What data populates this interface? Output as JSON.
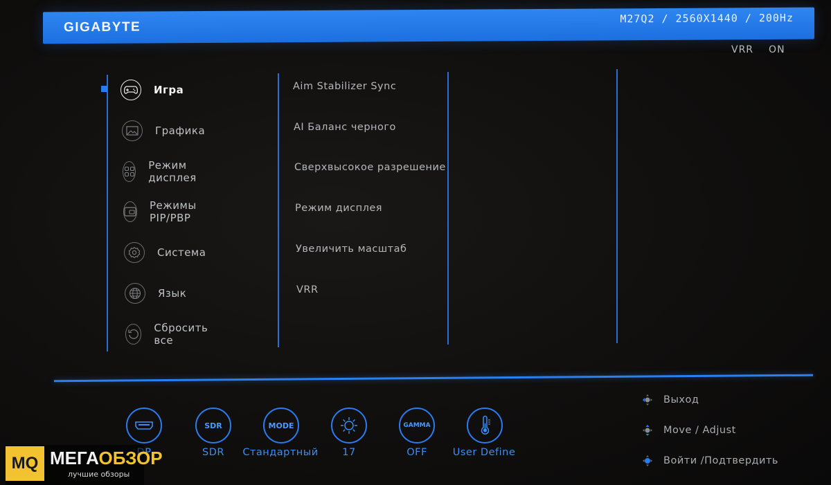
{
  "header": {
    "brand": "GIGABYTE",
    "model": "M27Q2",
    "resolution": "2560X1440",
    "refresh": "200Hz",
    "separator": "/"
  },
  "status": {
    "label": "VRR",
    "value": "ON"
  },
  "main_menu": {
    "items": [
      {
        "label": "Игра",
        "icon": "gamepad-icon",
        "active": true
      },
      {
        "label": "Графика",
        "icon": "picture-icon",
        "active": false
      },
      {
        "label": "Режим дисплея",
        "icon": "grid-icon",
        "active": false
      },
      {
        "label": "Режимы PIP/PBP",
        "icon": "pip-icon",
        "active": false
      },
      {
        "label": "Система",
        "icon": "gear-icon",
        "active": false
      },
      {
        "label": "Язык",
        "icon": "globe-icon",
        "active": false
      },
      {
        "label": "Сбросить все",
        "icon": "reset-icon",
        "active": false
      }
    ]
  },
  "sub_menu": {
    "items": [
      "Aim Stabilizer Sync",
      "AI Баланс черного",
      "Сверхвысокое разрешение",
      "Режим дисплея",
      "Увеличить масштаб",
      "VRR"
    ]
  },
  "quick_bar": {
    "items": [
      {
        "icon": "hdmi-icon",
        "label": "DP",
        "visible_label": "DP"
      },
      {
        "icon": "sdr-icon",
        "icon_text": "SDR",
        "label": "SDR"
      },
      {
        "icon": "mode-icon",
        "icon_text": "MODE",
        "label": "Стандартный"
      },
      {
        "icon": "brightness-icon",
        "label": "17"
      },
      {
        "icon": "gamma-icon",
        "icon_text": "GAMMA",
        "label": "OFF"
      },
      {
        "icon": "thermometer-icon",
        "label": "User Define"
      }
    ]
  },
  "hints": [
    {
      "icon": "joystick-left-icon",
      "label": "Выход"
    },
    {
      "icon": "joystick-updown-icon",
      "label": "Move / Adjust"
    },
    {
      "icon": "joystick-press-icon",
      "label": "Войти /Подтвердить"
    }
  ],
  "watermark": {
    "logo": "MQ",
    "title_part1": "МЕГА",
    "title_part2": "ОБЗОР",
    "subtitle": "лучшие обзоры"
  },
  "colors": {
    "accent": "#2a7cf0",
    "header": "#1c6fe0",
    "text": "#bfc2c6",
    "watermark": "#f2c230"
  }
}
